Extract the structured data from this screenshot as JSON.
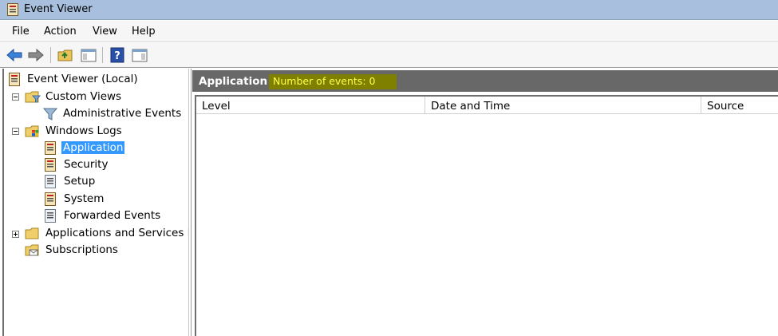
{
  "window": {
    "title": "Event Viewer"
  },
  "menu": {
    "items": [
      "File",
      "Action",
      "View",
      "Help"
    ]
  },
  "toolbar": {
    "buttons": [
      "back-arrow-icon",
      "forward-arrow-icon",
      "up-folder-icon",
      "show-hide-tree-icon",
      "help-icon",
      "show-hide-action-pane-icon"
    ]
  },
  "tree": {
    "root": "Event Viewer (Local)",
    "custom_views": "Custom Views",
    "administrative_events": "Administrative Events",
    "windows_logs": "Windows Logs",
    "application": "Application",
    "security": "Security",
    "setup": "Setup",
    "system": "System",
    "forwarded_events": "Forwarded Events",
    "applications_and_services": "Applications and Services Lo",
    "subscriptions": "Subscriptions"
  },
  "content": {
    "title": "Application",
    "event_count": "Number of events: 0",
    "columns": [
      "Level",
      "Date and Time",
      "Source"
    ]
  },
  "colors": {
    "titlebar": "#a8c0dd",
    "selection": "#3399ff",
    "header_bar": "#686868",
    "count_badge_bg": "#7f7f00",
    "count_badge_text": "#ffff4a"
  }
}
